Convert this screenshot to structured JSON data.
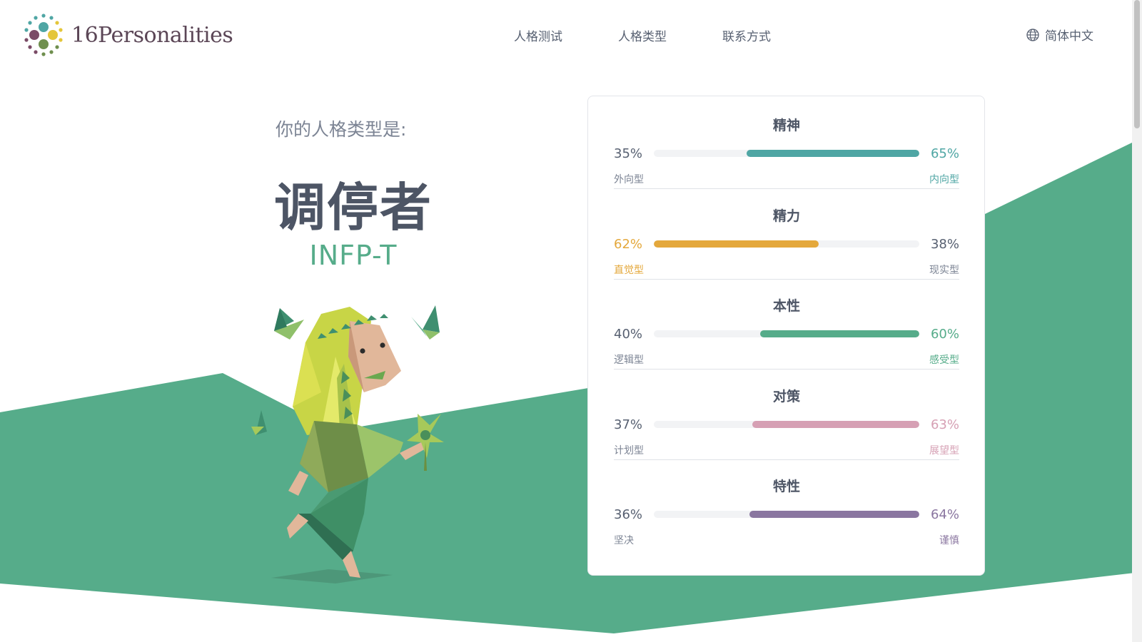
{
  "header": {
    "logo_text": "16Personalities",
    "nav": [
      "人格测试",
      "人格类型",
      "联系方式"
    ],
    "language": "简体中文"
  },
  "result": {
    "intro": "你的人格类型是:",
    "type_name": "调停者",
    "type_code": "INFP-T"
  },
  "traits": [
    {
      "title": "精神",
      "left_pct": "35%",
      "right_pct": "65%",
      "left_label": "外向型",
      "right_label": "内向型",
      "dominant": "right",
      "fill": 0.65,
      "color": "#4fa6a4"
    },
    {
      "title": "精力",
      "left_pct": "62%",
      "right_pct": "38%",
      "left_label": "直觉型",
      "right_label": "现实型",
      "dominant": "left",
      "fill": 0.62,
      "color": "#e4a83c"
    },
    {
      "title": "本性",
      "left_pct": "40%",
      "right_pct": "60%",
      "left_label": "逻辑型",
      "right_label": "感受型",
      "dominant": "right",
      "fill": 0.6,
      "color": "#56ac8a"
    },
    {
      "title": "对策",
      "left_pct": "37%",
      "right_pct": "63%",
      "left_label": "计划型",
      "right_label": "展望型",
      "dominant": "right",
      "fill": 0.63,
      "color": "#d6a0b4"
    },
    {
      "title": "特性",
      "left_pct": "36%",
      "right_pct": "64%",
      "left_label": "坚决",
      "right_label": "谨慎",
      "dominant": "right",
      "fill": 0.64,
      "color": "#8a76a0"
    }
  ],
  "icons": {
    "logo": "dotted-circle-logo-icon",
    "language": "globe-icon"
  },
  "colors": {
    "background_green": "#56ac8a",
    "text_dark": "#4d5565",
    "text_muted": "#7c8494"
  }
}
